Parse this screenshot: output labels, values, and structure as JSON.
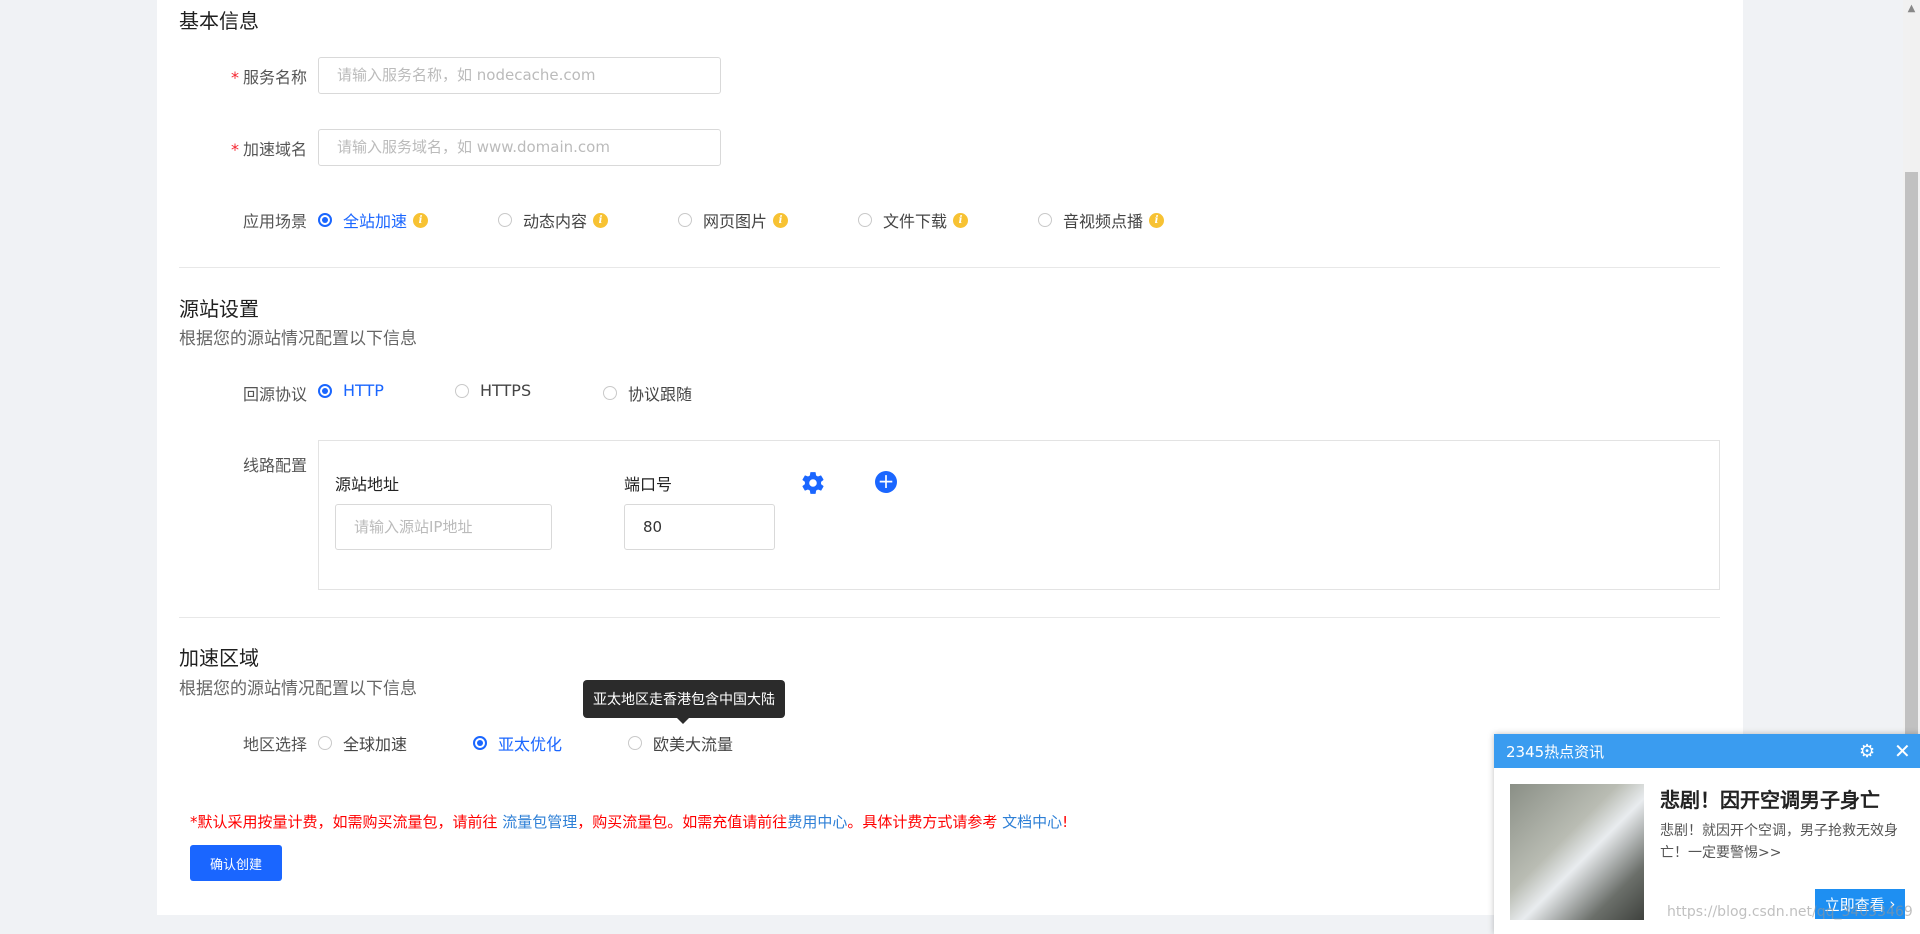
{
  "basic": {
    "title": "基本信息",
    "service_name": {
      "label": "服务名称",
      "placeholder": "请输入服务名称，如 nodecache.com"
    },
    "domain": {
      "label": "加速域名",
      "placeholder": "请输入服务域名，如 www.domain.com"
    },
    "scene": {
      "label": "应用场景",
      "options": [
        "全站加速",
        "动态内容",
        "网页图片",
        "文件下载",
        "音视频点播"
      ],
      "selected": "全站加速"
    }
  },
  "origin": {
    "title": "源站设置",
    "subtitle": "根据您的源站情况配置以下信息",
    "protocol": {
      "label": "回源协议",
      "options": [
        "HTTP",
        "HTTPS",
        "协议跟随"
      ],
      "selected": "HTTP"
    },
    "route": {
      "label": "线路配置",
      "address_label": "源站地址",
      "address_placeholder": "请输入源站IP地址",
      "port_label": "端口号",
      "port_value": "80"
    }
  },
  "region": {
    "title": "加速区域",
    "subtitle": "根据您的源站情况配置以下信息",
    "label": "地区选择",
    "options": [
      "全球加速",
      "亚太优化",
      "欧美大流量"
    ],
    "selected": "亚太优化",
    "tooltip": "亚太地区走香港包含中国大陆"
  },
  "notice": {
    "part1": "*默认采用按量计费，如需购买流量包，请前往 ",
    "link1": "流量包管理",
    "part2": "，购买流量包。如需充值请前往",
    "link2": "费用中心",
    "part3": "。具体计费方式请参考 ",
    "link3": "文档中心",
    "part4": "!"
  },
  "submit_label": "确认创建",
  "popup": {
    "header": "2345热点资讯",
    "title": "悲剧！因开空调男子身亡",
    "text": "悲剧！就因开个空调，男子抢救无效身亡！一定要警惕>>",
    "button": "立即查看"
  },
  "watermark": "https://blog.csdn.net/qq_34053469",
  "colors": {
    "primary": "#1a66ff",
    "required": "#f5222d",
    "info_icon": "#f7c233",
    "popup_header": "#3a9cf0"
  },
  "icons": [
    "info-icon",
    "gear-icon",
    "plus-circle-icon",
    "settings-icon",
    "close-icon"
  ]
}
